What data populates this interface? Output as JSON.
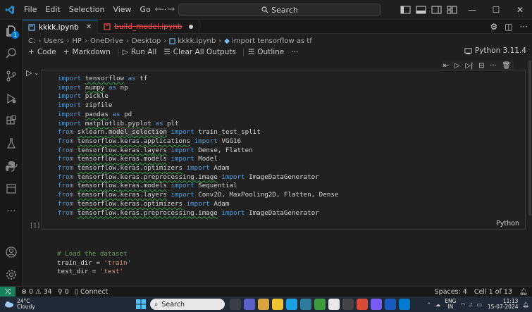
{
  "window": {
    "menu": [
      "File",
      "Edit",
      "Selection",
      "View",
      "Go",
      "···"
    ],
    "search_label": "Search"
  },
  "activity": {
    "badge": "1"
  },
  "tabs": [
    {
      "label": "kkkk.ipynb",
      "active": true,
      "close": "✕"
    },
    {
      "label": "build_model.ipynb",
      "active": false,
      "deleted": true
    }
  ],
  "breadcrumb": [
    "C:",
    "Users",
    "HP",
    "OneDrive",
    "Desktop",
    "kkkk.ipynb",
    "import tensorflow as tf"
  ],
  "toolbar": {
    "code": "Code",
    "markdown": "Markdown",
    "run_all": "Run All",
    "clear_outputs": "Clear All Outputs",
    "outline": "Outline",
    "more": "···",
    "kernel": "Python 3.11.4"
  },
  "cell1": {
    "exec_count": "[1]",
    "language": "Python",
    "lines": [
      "import tensorflow as tf",
      "import numpy as np",
      "import pickle",
      "import zipfile",
      "import pandas as pd",
      "import matplotlib.pyplot as plt",
      "from sklearn.model_selection import train_test_split",
      "from tensorflow.keras.applications import VGG16",
      "from tensorflow.keras.layers import Dense, Flatten",
      "from tensorflow.keras.models import Model",
      "from tensorflow.keras.optimizers import Adam",
      "from tensorflow.keras.preprocessing.image import ImageDataGenerator",
      "from tensorflow.keras.models import Sequential",
      "from tensorflow.keras.layers import Conv2D, MaxPooling2D, Flatten, Dense",
      "from tensorflow.keras.optimizers import Adam",
      "from tensorflow.keras.preprocessing.image import ImageDataGenerator"
    ]
  },
  "cell2": {
    "lines": [
      "# Load the dataset",
      "train_dir = 'train'",
      "test_dir = 'test'"
    ]
  },
  "statusbar": {
    "errors": "0",
    "warnings": "34",
    "ports": "0",
    "connect": "Connect",
    "spaces": "Spaces: 4",
    "cell": "Cell 1 of 13"
  },
  "taskbar": {
    "weather_temp": "24°C",
    "weather_desc": "Cloudy",
    "search": "Search",
    "lang": "ENG",
    "region": "IN",
    "time": "11:13",
    "date": "15-07-2024"
  }
}
